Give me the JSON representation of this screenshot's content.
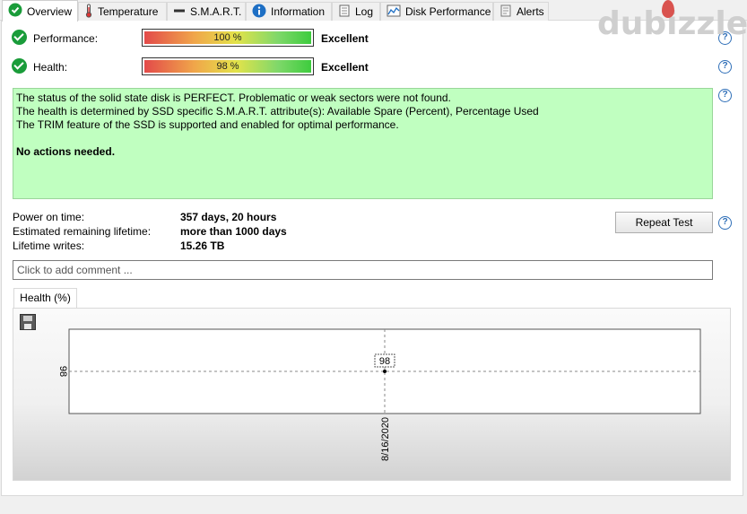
{
  "tabs": [
    {
      "label": "Overview",
      "icon": "check-circle-icon",
      "active": true
    },
    {
      "label": "Temperature",
      "icon": "thermometer-icon"
    },
    {
      "label": "S.M.A.R.T.",
      "icon": "dash-icon"
    },
    {
      "label": "Information",
      "icon": "info-icon"
    },
    {
      "label": "Log",
      "icon": "log-icon"
    },
    {
      "label": "Disk Performance",
      "icon": "chart-icon"
    },
    {
      "label": "Alerts",
      "icon": "alerts-icon"
    }
  ],
  "performance": {
    "label": "Performance:",
    "percent_text": "100 %",
    "percent": 100,
    "rating": "Excellent"
  },
  "health": {
    "label": "Health:",
    "percent_text": "98 %",
    "percent": 98,
    "rating": "Excellent"
  },
  "status": {
    "line1": "The status of the solid state disk is PERFECT. Problematic or weak sectors were not found.",
    "line2": "The health is determined by SSD specific S.M.A.R.T. attribute(s):  Available Spare (Percent), Percentage Used",
    "line3": "The TRIM feature of the SSD is supported and enabled for optimal performance.",
    "action": "No actions needed."
  },
  "info": {
    "power_on_label": "Power on time:",
    "power_on_value": "357 days, 20 hours",
    "remaining_label": "Estimated remaining lifetime:",
    "remaining_value": "more than 1000 days",
    "writes_label": "Lifetime writes:",
    "writes_value": "15.26 TB"
  },
  "repeat_test_label": "Repeat Test",
  "help_glyph": "?",
  "comment_placeholder": "Click to add comment ...",
  "chart_tab_label": "Health (%)",
  "watermark": "dubizzle",
  "colors": {
    "status_bg": "#c0ffc0",
    "check": "#1a9c3a",
    "help": "#2f6fb8"
  },
  "chart_data": {
    "type": "line",
    "title": "",
    "series": [
      {
        "values": [
          98
        ]
      }
    ],
    "x": [
      "8/16/2020"
    ],
    "y_ticks": [
      98
    ],
    "point_labels": [
      "98"
    ],
    "grid": true
  }
}
